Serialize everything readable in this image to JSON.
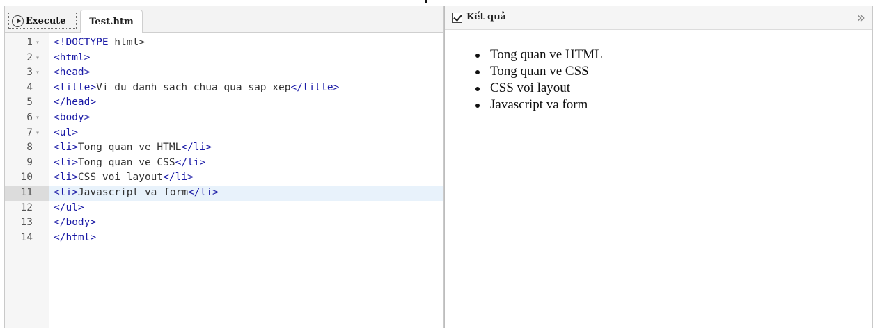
{
  "toolbar": {
    "execute_label": "Execute",
    "file_tab_label": "Test.htm"
  },
  "editor": {
    "active_line": 11,
    "lines": [
      {
        "num": "1",
        "fold": "▾",
        "parts": [
          [
            "tag",
            "<!DOCTYPE"
          ],
          [
            "text",
            " html>"
          ]
        ]
      },
      {
        "num": "2",
        "fold": "▾",
        "parts": [
          [
            "tag",
            "<html>"
          ]
        ]
      },
      {
        "num": "3",
        "fold": "▾",
        "parts": [
          [
            "tag",
            "<head>"
          ]
        ]
      },
      {
        "num": "4",
        "fold": "",
        "parts": [
          [
            "tag",
            "<title>"
          ],
          [
            "text",
            "Vi du danh sach chua qua sap xep"
          ],
          [
            "tag",
            "</title>"
          ]
        ]
      },
      {
        "num": "5",
        "fold": "",
        "parts": [
          [
            "tag",
            "</head>"
          ]
        ]
      },
      {
        "num": "6",
        "fold": "▾",
        "parts": [
          [
            "tag",
            "<body>"
          ]
        ]
      },
      {
        "num": "7",
        "fold": "▾",
        "parts": [
          [
            "tag",
            "<ul>"
          ]
        ]
      },
      {
        "num": "8",
        "fold": "",
        "parts": [
          [
            "tag",
            "<li>"
          ],
          [
            "text",
            "Tong quan ve HTML"
          ],
          [
            "tag",
            "</li>"
          ]
        ]
      },
      {
        "num": "9",
        "fold": "",
        "parts": [
          [
            "tag",
            "<li>"
          ],
          [
            "text",
            "Tong quan ve CSS"
          ],
          [
            "tag",
            "</li>"
          ]
        ]
      },
      {
        "num": "10",
        "fold": "",
        "parts": [
          [
            "tag",
            "<li>"
          ],
          [
            "text",
            "CSS voi layout"
          ],
          [
            "tag",
            "</li>"
          ]
        ]
      },
      {
        "num": "11",
        "fold": "",
        "parts": [
          [
            "tag",
            "<li>"
          ],
          [
            "text",
            "Javascript va"
          ],
          [
            "cursor",
            ""
          ],
          [
            "text",
            " form"
          ],
          [
            "tag",
            "</li>"
          ]
        ]
      },
      {
        "num": "12",
        "fold": "",
        "parts": [
          [
            "tag",
            "</ul>"
          ]
        ]
      },
      {
        "num": "13",
        "fold": "",
        "parts": [
          [
            "tag",
            "</body>"
          ]
        ]
      },
      {
        "num": "14",
        "fold": "",
        "parts": [
          [
            "tag",
            "</html>"
          ]
        ]
      }
    ]
  },
  "result_panel": {
    "title": "Kết quả",
    "expand_icon": "»",
    "items": [
      "Tong quan ve HTML",
      "Tong quan ve CSS",
      "CSS voi layout",
      "Javascript va form"
    ]
  },
  "icons": {
    "execute": "play-circle-icon",
    "result": "checkbox-icon",
    "expand": "double-chevron-right-icon"
  },
  "colors": {
    "tag": "#1a1aa6",
    "text": "#333333",
    "active_line": "#e8f2fb"
  }
}
